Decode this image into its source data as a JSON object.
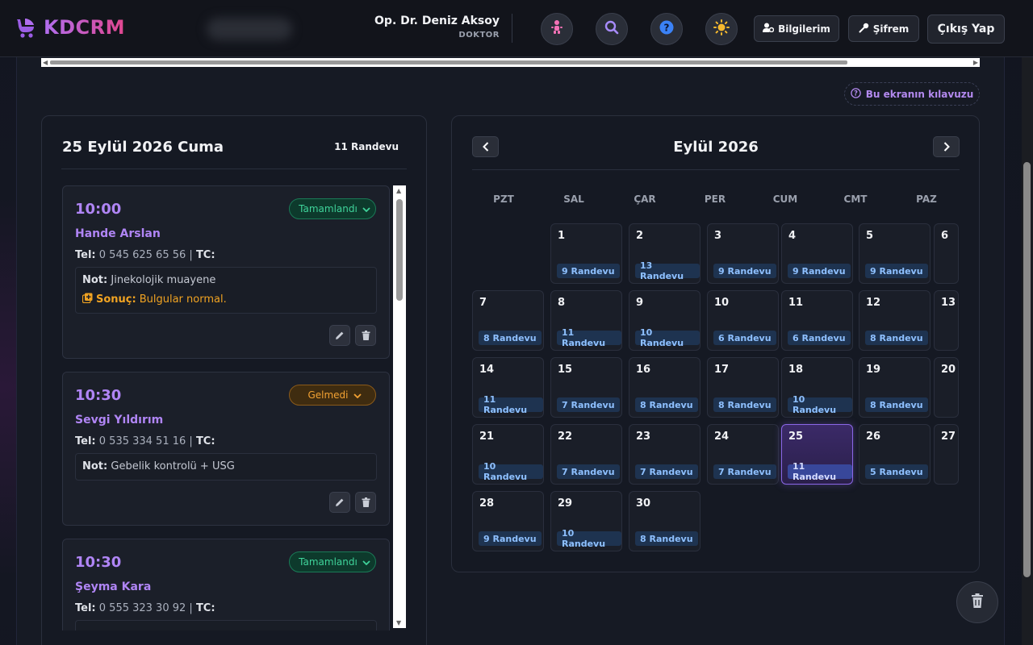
{
  "brand": {
    "name": "KDCRM"
  },
  "user": {
    "name": "Op. Dr. Deniz Aksoy",
    "role": "DOKTOR"
  },
  "toolbar": {
    "info_label": "Bilgilerim",
    "password_label": "Şifrem",
    "logout_label": "Çıkış Yap"
  },
  "guide": {
    "label": "Bu ekranın kılavuzu"
  },
  "day": {
    "title": "25 Eylül 2026 Cuma",
    "count": "11 Randevu"
  },
  "appointments": [
    {
      "time": "10:00",
      "status": "Tamamlandı",
      "name": "Hande Arslan",
      "tel_label": "Tel:",
      "tel": "0 545 625 65 56",
      "tc_label": "TC:",
      "note_label": "Not:",
      "note": "Jinekolojik muayene",
      "result_label": "Sonuç:",
      "result": "Bulgular normal."
    },
    {
      "time": "10:30",
      "status": "Gelmedi",
      "name": "Sevgi Yıldırım",
      "tel_label": "Tel:",
      "tel": "0 535 334 51 16",
      "tc_label": "TC:",
      "note_label": "Not:",
      "note": "Gebelik kontrolü + USG"
    },
    {
      "time": "10:30",
      "status": "Tamamlandı",
      "name": "Şeyma Kara",
      "tel_label": "Tel:",
      "tel": "0 555 323 30 92",
      "tc_label": "TC:"
    }
  ],
  "calendar": {
    "month_title": "Eylül 2026",
    "weekdays": [
      "PZT",
      "SAL",
      "ÇAR",
      "PER",
      "CUM",
      "CMT",
      "PAZ"
    ],
    "weeks": [
      [
        null,
        {
          "day": "1",
          "badge": "9 Randevu"
        },
        {
          "day": "2",
          "badge": "13 Randevu"
        },
        {
          "day": "3",
          "badge": "9 Randevu"
        },
        {
          "day": "4",
          "badge": "9 Randevu"
        },
        {
          "day": "5",
          "badge": "9 Randevu"
        },
        {
          "day": "6"
        }
      ],
      [
        {
          "day": "7",
          "badge": "8 Randevu"
        },
        {
          "day": "8",
          "badge": "11 Randevu"
        },
        {
          "day": "9",
          "badge": "10 Randevu"
        },
        {
          "day": "10",
          "badge": "6 Randevu"
        },
        {
          "day": "11",
          "badge": "6 Randevu"
        },
        {
          "day": "12",
          "badge": "8 Randevu"
        },
        {
          "day": "13"
        }
      ],
      [
        {
          "day": "14",
          "badge": "11 Randevu"
        },
        {
          "day": "15",
          "badge": "7 Randevu"
        },
        {
          "day": "16",
          "badge": "8 Randevu"
        },
        {
          "day": "17",
          "badge": "8 Randevu"
        },
        {
          "day": "18",
          "badge": "10 Randevu"
        },
        {
          "day": "19",
          "badge": "8 Randevu"
        },
        {
          "day": "20"
        }
      ],
      [
        {
          "day": "21",
          "badge": "10 Randevu"
        },
        {
          "day": "22",
          "badge": "7 Randevu"
        },
        {
          "day": "23",
          "badge": "7 Randevu"
        },
        {
          "day": "24",
          "badge": "7 Randevu"
        },
        {
          "day": "25",
          "badge": "11 Randevu",
          "selected": true
        },
        {
          "day": "26",
          "badge": "5 Randevu"
        },
        {
          "day": "27"
        }
      ],
      [
        {
          "day": "28",
          "badge": "9 Randevu"
        },
        {
          "day": "29",
          "badge": "10 Randevu"
        },
        {
          "day": "30",
          "badge": "8 Randevu"
        },
        null,
        null,
        null,
        null
      ]
    ]
  },
  "colors": {
    "accent": "#b085f5",
    "done": "#3fd39a",
    "missed": "#f3a233",
    "badge": "#8ec0ff"
  }
}
